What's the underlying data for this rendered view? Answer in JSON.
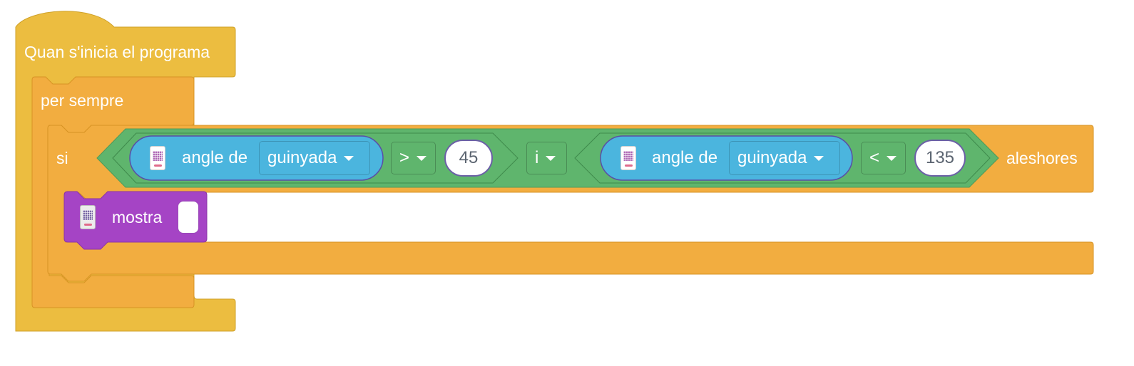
{
  "hat": {
    "label": "Quan s'inicia el programa"
  },
  "forever": {
    "label": "per sempre"
  },
  "if_block": {
    "label": "si",
    "then_label": "aleshores",
    "condition": {
      "operator": "i",
      "left": {
        "reporter_label": "angle de",
        "axis": "guinyada",
        "comparison": ">",
        "value": "45"
      },
      "right": {
        "reporter_label": "angle de",
        "axis": "guinyada",
        "comparison": "<",
        "value": "135"
      }
    }
  },
  "show_block": {
    "label": "mostra",
    "text_value": ""
  },
  "colors": {
    "events": "#ecbd40",
    "control": "#f2ad40",
    "operators": "#5fb56d",
    "sensing": "#4bb5de",
    "display": "#a544c5"
  },
  "icons": {
    "hub": "microbit-device-icon",
    "dropdown": "caret-down-icon"
  }
}
